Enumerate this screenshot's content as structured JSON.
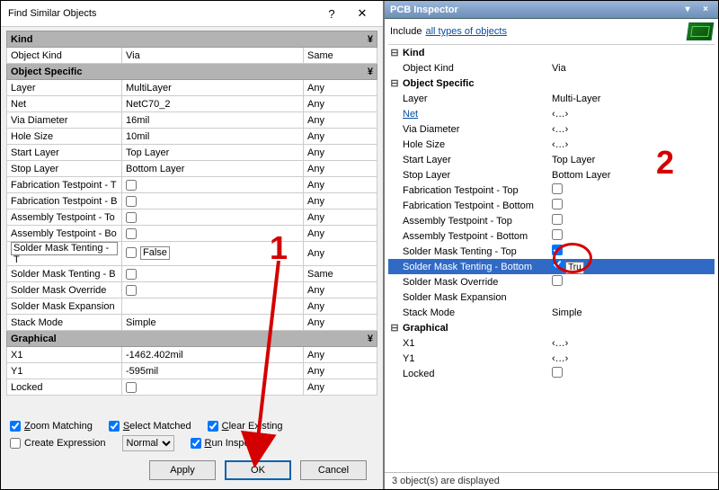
{
  "dialog": {
    "title": "Find Similar Objects",
    "help_glyph": "?",
    "close_glyph": "✕",
    "sections": {
      "kind": "Kind",
      "object_specific": "Object Specific",
      "graphical": "Graphical"
    },
    "rows": {
      "object_kind": {
        "label": "Object Kind",
        "value": "Via",
        "match": "Same"
      },
      "layer": {
        "label": "Layer",
        "value": "MultiLayer",
        "match": "Any"
      },
      "net": {
        "label": "Net",
        "value": "NetC70_2",
        "match": "Any"
      },
      "via_diameter": {
        "label": "Via Diameter",
        "value": "16mil",
        "match": "Any"
      },
      "hole_size": {
        "label": "Hole Size",
        "value": "10mil",
        "match": "Any"
      },
      "start_layer": {
        "label": "Start Layer",
        "value": "Top Layer",
        "match": "Any"
      },
      "stop_layer": {
        "label": "Stop Layer",
        "value": "Bottom Layer",
        "match": "Any"
      },
      "fab_tp_top": {
        "label": "Fabrication Testpoint - T",
        "checked": false,
        "match": "Any"
      },
      "fab_tp_bot": {
        "label": "Fabrication Testpoint - B",
        "checked": false,
        "match": "Any"
      },
      "asm_tp_top": {
        "label": "Assembly Testpoint - To",
        "checked": false,
        "match": "Any"
      },
      "asm_tp_bot": {
        "label": "Assembly Testpoint - Bo",
        "checked": false,
        "match": "Any"
      },
      "smt_top": {
        "label": "Solder Mask Tenting - T",
        "checked": false,
        "false_text": "False",
        "match": "Any"
      },
      "smt_bot": {
        "label": "Solder Mask Tenting - B",
        "checked": false,
        "match": "Same"
      },
      "sm_override": {
        "label": "Solder Mask Override",
        "checked": false,
        "match": "Any"
      },
      "sm_expansion": {
        "label": "Solder Mask Expansion",
        "value": "",
        "match": "Any"
      },
      "stack_mode": {
        "label": "Stack Mode",
        "value": "Simple",
        "match": "Any"
      },
      "x1": {
        "label": "X1",
        "value": "-1462.402mil",
        "match": "Any"
      },
      "y1": {
        "label": "Y1",
        "value": "-595mil",
        "match": "Any"
      },
      "locked": {
        "label": "Locked",
        "checked": false,
        "match": "Any"
      }
    },
    "options": {
      "zoom_matching": {
        "label_pre": "",
        "accel": "Z",
        "label_post": "oom Matching",
        "checked": true
      },
      "select_matched": {
        "label_pre": "",
        "accel": "S",
        "label_post": "elect Matched",
        "checked": true
      },
      "clear_existing": {
        "label_pre": "",
        "accel": "C",
        "label_post": "lear Existing",
        "checked": true
      },
      "create_expression": {
        "label_pre": "Create ",
        "accel": "",
        "label_post": "Expression",
        "checked": false
      },
      "run_inspector": {
        "label_pre": "",
        "accel": "R",
        "label_post": "un Inspector",
        "checked": true
      },
      "combo_value": "Normal"
    },
    "buttons": {
      "apply": "Apply",
      "ok": "OK",
      "cancel": "Cancel"
    }
  },
  "inspector": {
    "title": "PCB Inspector",
    "include_prefix": "Include",
    "include_link": "all types of objects",
    "sections": {
      "kind": "Kind",
      "object_specific": "Object Specific",
      "graphical": "Graphical"
    },
    "rows": {
      "object_kind": {
        "label": "Object Kind",
        "value": "Via"
      },
      "layer": {
        "label": "Layer",
        "value": "Multi-Layer"
      },
      "net": {
        "label": "Net",
        "value": "‹…›",
        "is_link": true
      },
      "via_diameter": {
        "label": "Via Diameter",
        "value": "‹…›"
      },
      "hole_size": {
        "label": "Hole Size",
        "value": "‹…›"
      },
      "start_layer": {
        "label": "Start Layer",
        "value": "Top Layer"
      },
      "stop_layer": {
        "label": "Stop Layer",
        "value": "Bottom Layer"
      },
      "fab_tp_top": {
        "label": "Fabrication Testpoint - Top",
        "checked": false
      },
      "fab_tp_bot": {
        "label": "Fabrication Testpoint - Bottom",
        "checked": false
      },
      "asm_tp_top": {
        "label": "Assembly Testpoint - Top",
        "checked": false
      },
      "asm_tp_bot": {
        "label": "Assembly Testpoint - Bottom",
        "checked": false
      },
      "smt_top": {
        "label": "Solder Mask Tenting - Top",
        "checked": true
      },
      "smt_bot": {
        "label": "Solder Mask Tenting - Bottom",
        "checked": true,
        "edit": "Tru"
      },
      "sm_override": {
        "label": "Solder Mask Override",
        "checked": false
      },
      "sm_expansion": {
        "label": "Solder Mask Expansion",
        "value": ""
      },
      "stack_mode": {
        "label": "Stack Mode",
        "value": "Simple"
      },
      "x1": {
        "label": "X1",
        "value": "‹…›"
      },
      "y1": {
        "label": "Y1",
        "value": "‹…›"
      },
      "locked": {
        "label": "Locked",
        "checked": false
      }
    },
    "status": "3 object(s) are displayed"
  },
  "annotations": {
    "one": "1",
    "two": "2"
  }
}
